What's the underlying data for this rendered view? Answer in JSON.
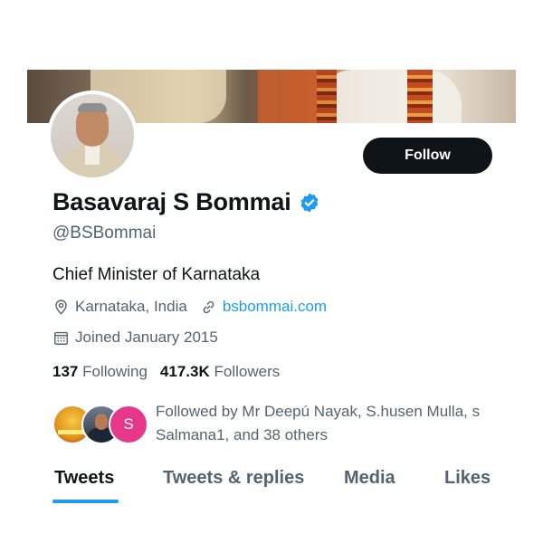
{
  "profile": {
    "name": "Basavaraj S Bommai",
    "handle": "@BSBommai",
    "bio": "Chief Minister of Karnataka",
    "location": "Karnataka, India",
    "website": "bsbommai.com",
    "joined": "Joined January 2015",
    "verified": true
  },
  "actions": {
    "follow_label": "Follow"
  },
  "stats": {
    "following_count": "137",
    "following_label": "Following",
    "followers_count": "417.3K",
    "followers_label": "Followers"
  },
  "followed_by": {
    "text": "Followed by Mr Deepú Nayak, S.husen Mulla, s Salmana1, and 38 others",
    "avatar_initial": "S"
  },
  "tabs": [
    {
      "label": "Tweets",
      "active": true
    },
    {
      "label": "Tweets & replies",
      "active": false
    },
    {
      "label": "Media",
      "active": false
    },
    {
      "label": "Likes",
      "active": false
    }
  ],
  "colors": {
    "accent": "#1d9bf0",
    "text_primary": "#0f1419",
    "text_secondary": "#536471",
    "button_bg": "#0f1419"
  },
  "icons": {
    "verified": "verified-badge-icon",
    "location": "location-pin-icon",
    "link": "link-icon",
    "calendar": "calendar-icon"
  }
}
